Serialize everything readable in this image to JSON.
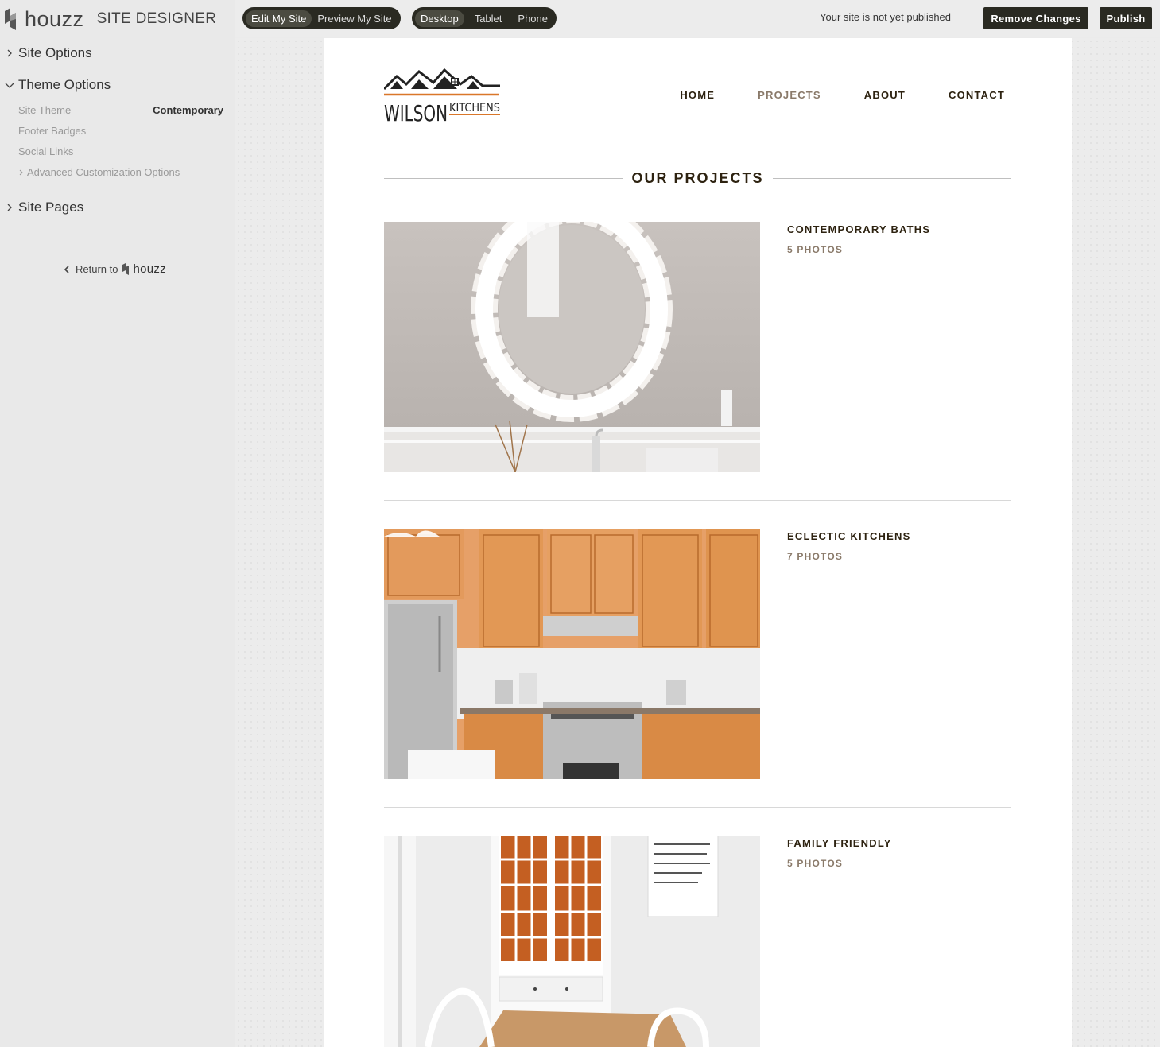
{
  "app": {
    "brand": "houzz",
    "title": "SITE DESIGNER"
  },
  "sidebar": {
    "sections": [
      {
        "label": "Site Options",
        "expanded": false
      },
      {
        "label": "Theme Options",
        "expanded": true
      },
      {
        "label": "Site Pages",
        "expanded": false
      }
    ],
    "theme_options": {
      "site_theme_label": "Site Theme",
      "site_theme_value": "Contemporary",
      "footer_badges": "Footer Badges",
      "social_links": "Social Links",
      "advanced": "Advanced Customization Options"
    },
    "return_label": "Return to",
    "return_brand": "houzz"
  },
  "toolbar": {
    "mode_options": [
      "Edit My Site",
      "Preview My Site"
    ],
    "mode_selected": "Edit My Site",
    "device_options": [
      "Desktop",
      "Tablet",
      "Phone"
    ],
    "device_selected": "Desktop",
    "status": "Your site is not yet published",
    "remove_changes": "Remove Changes",
    "publish": "Publish"
  },
  "site": {
    "logo_text_1": "WILSON",
    "logo_text_2": "KITCHENS",
    "nav": [
      {
        "label": "HOME",
        "current": false
      },
      {
        "label": "PROJECTS",
        "current": true
      },
      {
        "label": "ABOUT",
        "current": false
      },
      {
        "label": "CONTACT",
        "current": false
      }
    ],
    "heading": "OUR PROJECTS",
    "projects": [
      {
        "title": "CONTEMPORARY BATHS",
        "count": "5 PHOTOS",
        "image": "bathroom-mirror"
      },
      {
        "title": "ECLECTIC KITCHENS",
        "count": "7 PHOTOS",
        "image": "orange-kitchen"
      },
      {
        "title": "FAMILY FRIENDLY",
        "count": "5 PHOTOS",
        "image": "white-dining-room"
      }
    ]
  },
  "colors": {
    "dark": "#2a2a22",
    "accent_brown": "#8a7a6a",
    "logo_orange": "#d9772a"
  }
}
